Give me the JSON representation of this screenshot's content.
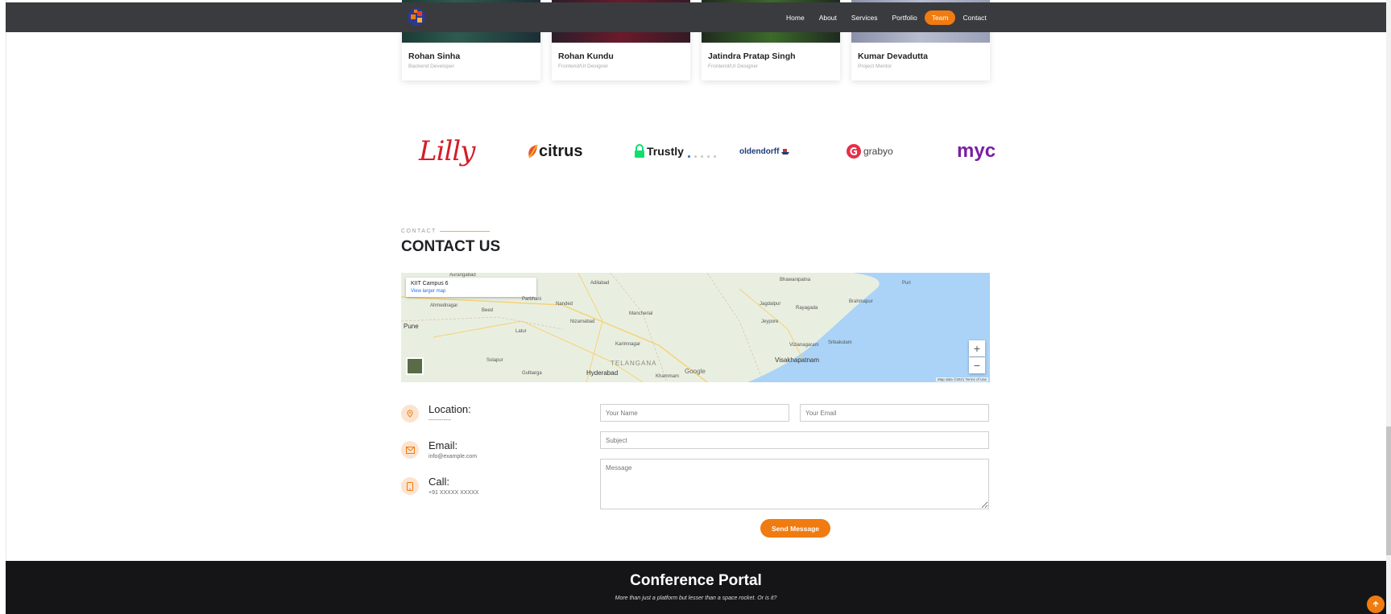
{
  "nav": {
    "items": [
      {
        "label": "Home"
      },
      {
        "label": "About"
      },
      {
        "label": "Services"
      },
      {
        "label": "Portfolio"
      },
      {
        "label": "Team",
        "active": true
      },
      {
        "label": "Contact"
      }
    ]
  },
  "team": [
    {
      "name": "Rohan Sinha",
      "role": "Backend Developer"
    },
    {
      "name": "Rohan Kundu",
      "role": "Frontend/UI Designer"
    },
    {
      "name": "Jatindra Pratap Singh",
      "role": "Frontend/UI Designer"
    },
    {
      "name": "Kumar Devadutta",
      "role": "Project Mentor"
    }
  ],
  "clients": {
    "lilly": "Lilly",
    "citrus": "citrus",
    "trustly": "Trustly",
    "oldendorff": "oldendorff",
    "grabyo": "grabyo",
    "myc": "myc"
  },
  "contact": {
    "eyebrow": "CONTACT",
    "title": "CONTACT US",
    "map": {
      "place_name": "KIIT Campus 6",
      "view_larger": "View larger map",
      "labels": {
        "aurangabad": "Aurangabad",
        "ahmednagar": "Ahmednagar",
        "pune": "Pune",
        "latur": "Latur",
        "solapur": "Solapur",
        "gulbarga": "Gulbarga",
        "nanded": "Nanded",
        "nizamabad": "Nizamabad",
        "adilabad": "Adilabad",
        "mancherial": "Mancherial",
        "karimnagar": "Karimnagar",
        "telangana": "TELANGANA",
        "hyderabad": "Hyderabad",
        "khammam": "Khammam",
        "jagdalpur": "Jagdalpur",
        "jeypore": "Jeypore",
        "rayagada": "Rayagada",
        "bhawanipatna": "Bhawanipatna",
        "brahmapur": "Brahmapur",
        "puri": "Puri",
        "vizianagaram": "Vizianagaram",
        "srikakulam": "Srikakulam",
        "visakhapatnam": "Visakhapatnam",
        "parbhani": "Parbhani",
        "beed": "Beed"
      },
      "google": "Google",
      "terms": "Map data ©2021   Terms of Use",
      "zoom_in": "+",
      "zoom_out": "−"
    },
    "location_label": "Location:",
    "location_value": "------------",
    "email_label": "Email:",
    "email_value": "info@example.com",
    "call_label": "Call:",
    "call_value": "+91 XXXXX XXXXX",
    "form": {
      "name_placeholder": "Your Name",
      "email_placeholder": "Your Email",
      "subject_placeholder": "Subject",
      "message_placeholder": "Message",
      "send_label": "Send Message"
    }
  },
  "footer": {
    "title": "Conference Portal",
    "tagline": "More than just a platform but lesser than a space rocket. Or is it?"
  },
  "colors": {
    "accent": "#f07b10",
    "header_bg": "#3a3b3e",
    "footer_bg": "#151518"
  }
}
